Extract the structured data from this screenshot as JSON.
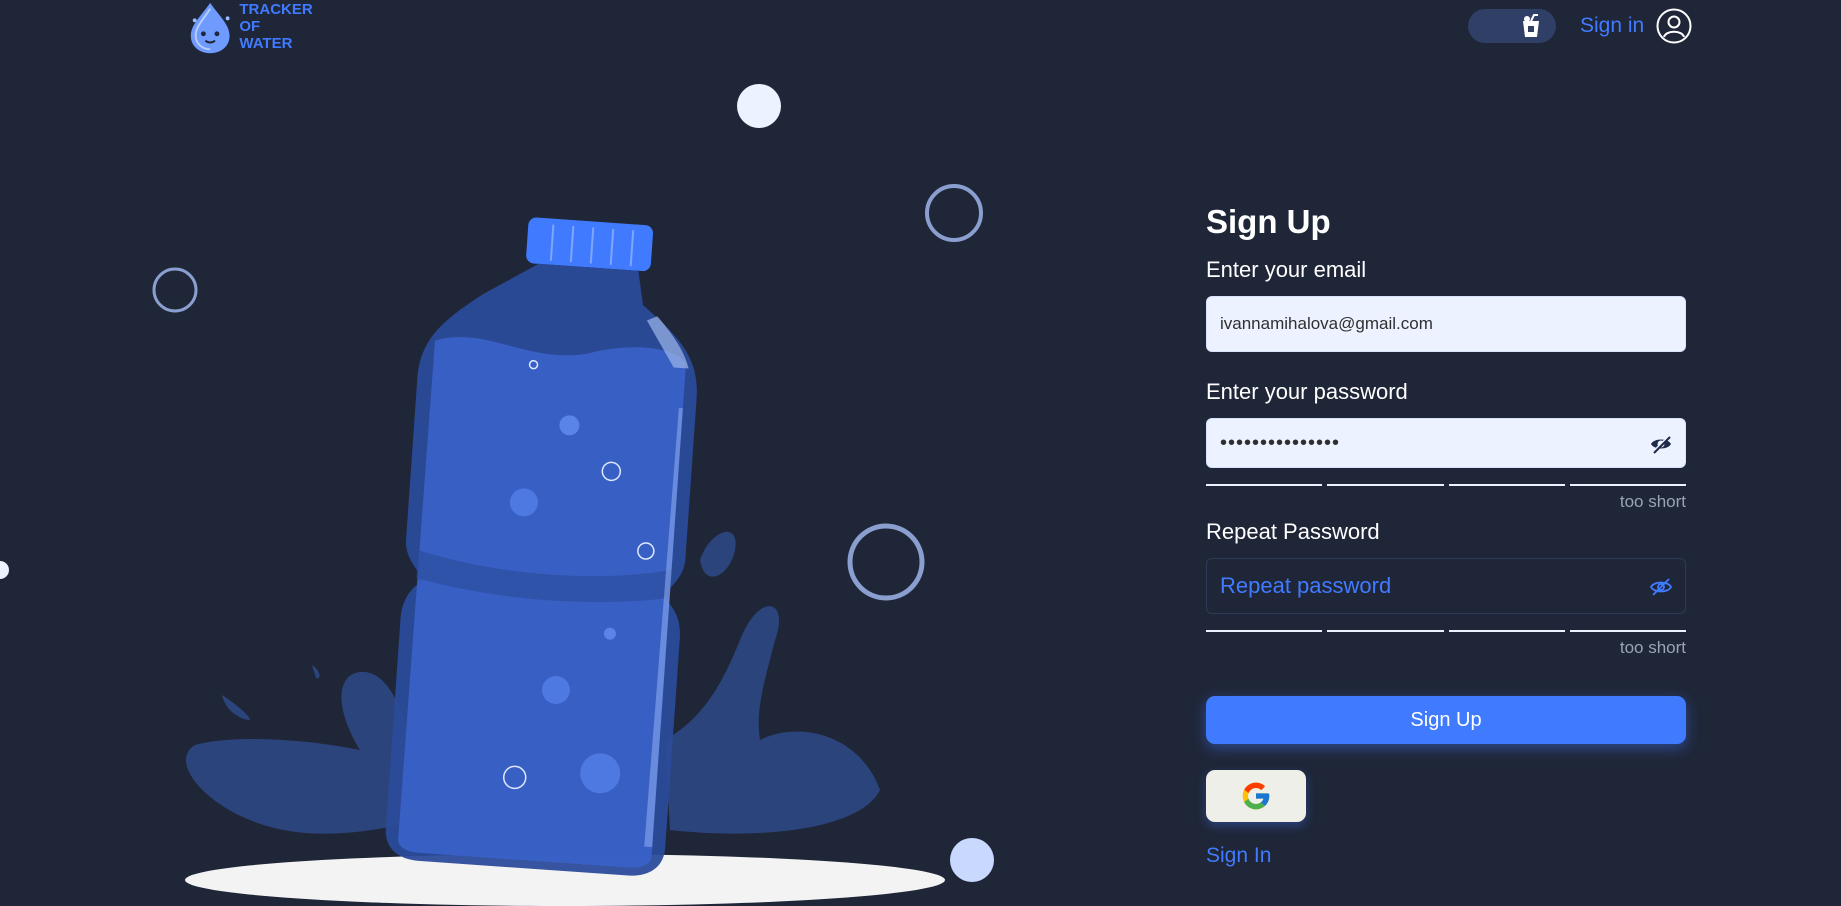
{
  "logo": {
    "line1": "TRACKER",
    "line2": "OF WATER"
  },
  "header": {
    "signin_label": "Sign in"
  },
  "icons": {
    "logo": "water-drop-mascot",
    "theme": "glass-drink-icon",
    "user": "user-circle-icon",
    "eye_open": "eye-icon",
    "eye_closed": "eye-off-icon",
    "google": "google-icon"
  },
  "colors": {
    "background": "#1f2638",
    "accent": "#407bff",
    "field_bg": "#ecf2ff"
  },
  "form": {
    "title": "Sign Up",
    "email_label": "Enter your email",
    "email_value": "ivannamihalova@gmail.com",
    "password_label": "Enter your password",
    "password_value": "•••••••••••••••",
    "password_hint": "too short",
    "repeat_label": "Repeat Password",
    "repeat_placeholder": "Repeat password",
    "repeat_hint": "too short",
    "submit_label": "Sign Up",
    "signin_link": "Sign In"
  }
}
